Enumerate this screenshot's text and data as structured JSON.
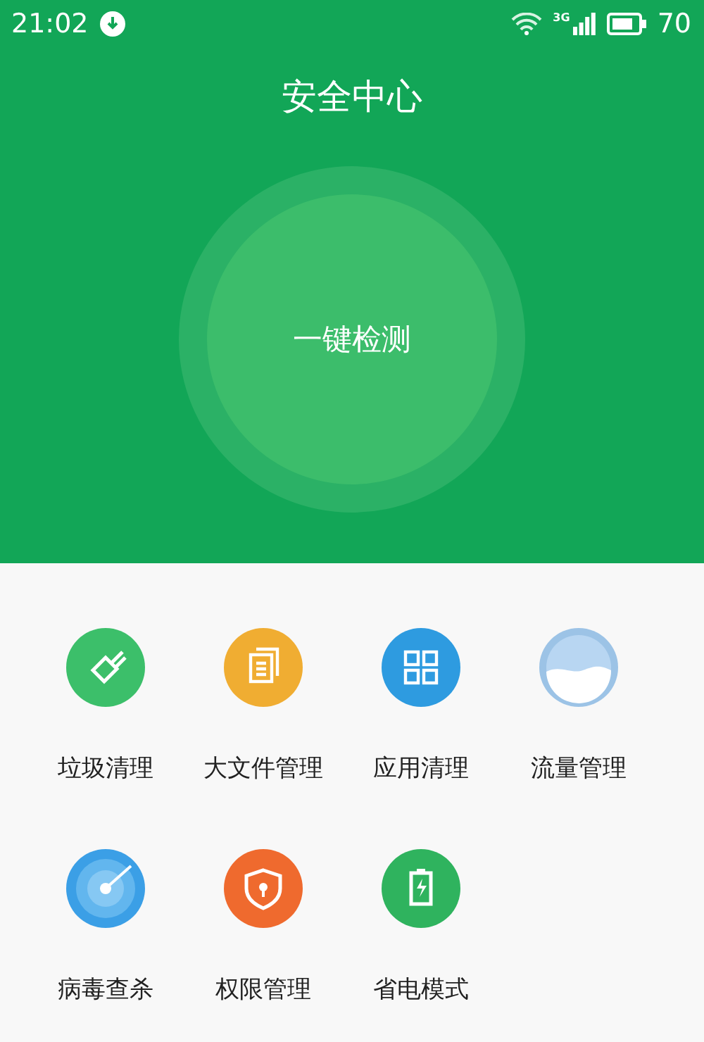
{
  "status_bar": {
    "time": "21:02",
    "network": "3G",
    "battery": "70"
  },
  "header": {
    "title": "安全中心",
    "scan_button": "一键检测"
  },
  "tools": [
    {
      "label": "垃圾清理",
      "kind": "broom",
      "color": "#3cbf6a"
    },
    {
      "label": "大文件管理",
      "kind": "files",
      "color": "#f0ad32"
    },
    {
      "label": "应用清理",
      "kind": "apps",
      "color": "#2e9be0"
    },
    {
      "label": "流量管理",
      "kind": "traffic",
      "color": "#9cc3e6"
    },
    {
      "label": "病毒查杀",
      "kind": "radar",
      "color": "#3b9fe6"
    },
    {
      "label": "权限管理",
      "kind": "shield",
      "color": "#ef6a2e"
    },
    {
      "label": "省电模式",
      "kind": "battery",
      "color": "#2fb35e"
    }
  ]
}
